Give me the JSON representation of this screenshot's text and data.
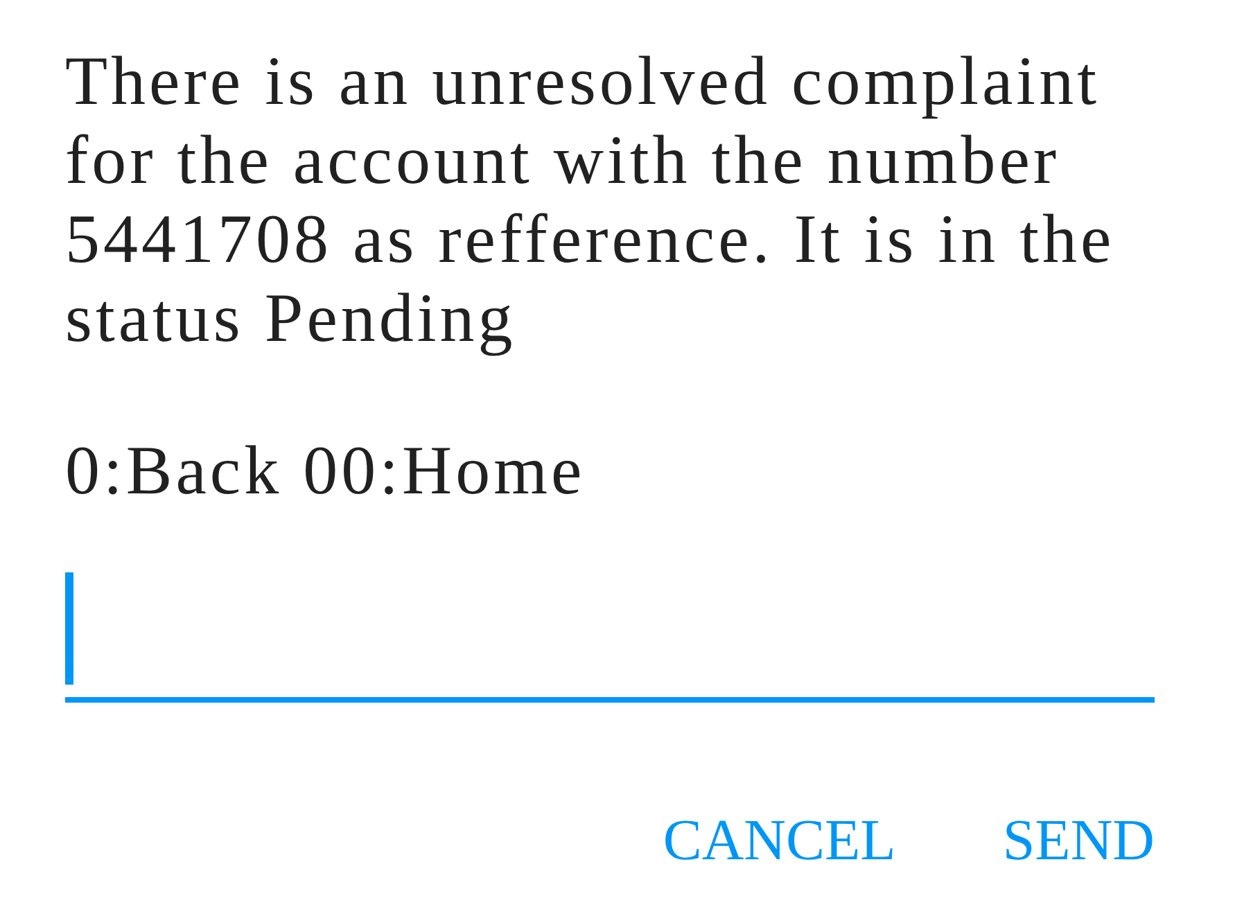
{
  "dialog": {
    "message": "There is an unresolved complaint for the account with the number 5441708 as refference. It is in the status Pending",
    "options": "0:Back 00:Home"
  },
  "input_field": {
    "focused": true
  },
  "buttons": [
    "CANCEL",
    "SEND"
  ]
}
